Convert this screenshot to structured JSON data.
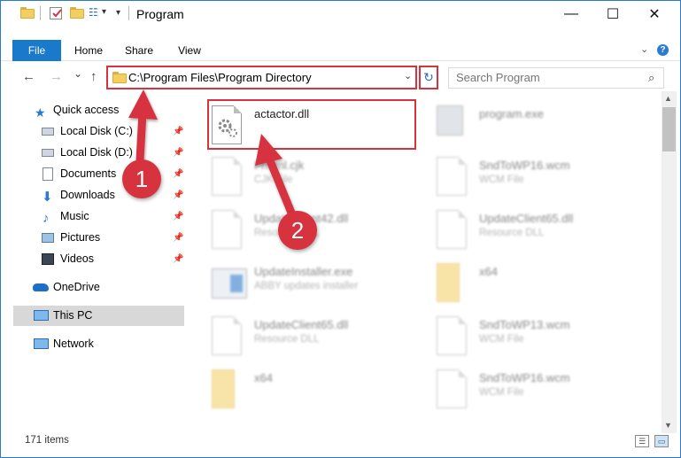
{
  "window": {
    "title": "Program",
    "controls": [
      "—",
      "☐",
      "✕"
    ]
  },
  "ribbon": {
    "tabs": [
      "File",
      "Home",
      "Share",
      "View"
    ],
    "help": "?"
  },
  "navigation": {
    "back": "←",
    "forward": "→",
    "recent": "⌄",
    "up": "↑"
  },
  "address": {
    "path": "C:\\Program Files\\Program Directory"
  },
  "search": {
    "placeholder": "Search Program"
  },
  "sidebar": {
    "items": [
      {
        "label": "Quick access",
        "icon": "star-icon"
      },
      {
        "label": "Local Disk (C:)",
        "icon": "drive-icon",
        "pinned": true
      },
      {
        "label": "Local Disk (D:)",
        "icon": "drive-icon",
        "pinned": true
      },
      {
        "label": "Documents",
        "icon": "documents-icon",
        "pinned": true
      },
      {
        "label": "Downloads",
        "icon": "downloads-icon",
        "pinned": true
      },
      {
        "label": "Music",
        "icon": "music-icon",
        "pinned": true
      },
      {
        "label": "Pictures",
        "icon": "pictures-icon",
        "pinned": true
      },
      {
        "label": "Videos",
        "icon": "videos-icon",
        "pinned": true
      },
      {
        "label": "OneDrive",
        "icon": "cloud-icon"
      },
      {
        "label": "This PC",
        "icon": "computer-icon",
        "selected": true
      },
      {
        "label": "Network",
        "icon": "network-icon"
      }
    ]
  },
  "files": [
    {
      "name": "actactor.dll",
      "type": "",
      "highlighted": true
    },
    {
      "name": "program.exe",
      "type": ""
    },
    {
      "name": "Frmml.cjk",
      "type": "CJK File"
    },
    {
      "name": "SndToWP16.wcm",
      "type": "WCM File"
    },
    {
      "name": "UpdateClient42.dll",
      "type": "Resource DLL"
    },
    {
      "name": "UpdateClient65.dll",
      "type": "Resource DLL"
    },
    {
      "name": "UpdateInstaller.exe",
      "type": "ABBY updates installer"
    },
    {
      "name": "x64",
      "type": ""
    },
    {
      "name": "UpdateClient65.dll",
      "type": "Resource DLL"
    },
    {
      "name": "SndToWP13.wcm",
      "type": "WCM File"
    },
    {
      "name": "x64",
      "type": ""
    },
    {
      "name": "SndToWP16.wcm",
      "type": "WCM File"
    }
  ],
  "status": {
    "count": "171 items"
  },
  "callouts": [
    "1",
    "2"
  ],
  "colors": {
    "accent": "#1979ca",
    "highlight": "#d6333f",
    "selected_row": "#d8d8d8"
  }
}
